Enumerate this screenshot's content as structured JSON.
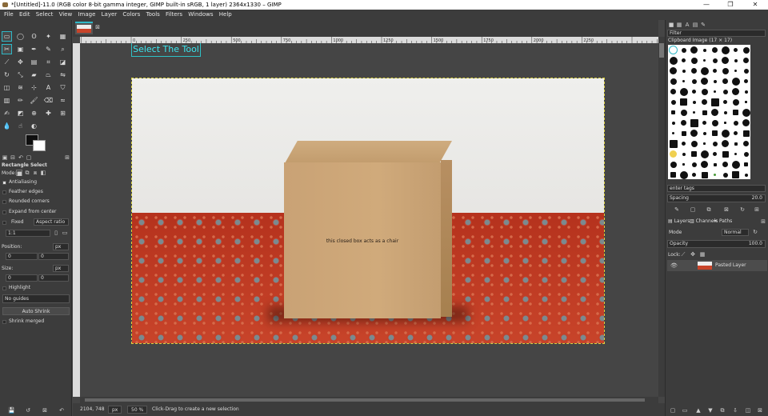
{
  "window": {
    "title": "*[Untitled]-11.0 (RGB color 8-bit gamma integer, GIMP built-in sRGB, 1 layer) 2364x1330 – GIMP",
    "min_glyph": "—",
    "max_glyph": "❐",
    "close_glyph": "✕"
  },
  "menu": [
    "File",
    "Edit",
    "Select",
    "View",
    "Image",
    "Layer",
    "Colors",
    "Tools",
    "Filters",
    "Windows",
    "Help"
  ],
  "tool_options": {
    "title": "Rectangle Select",
    "mode_label": "Mode:",
    "antialiasing": "Antialiasing",
    "feather": "Feather edges",
    "rounded": "Rounded corners",
    "expand": "Expand from center",
    "fixed_label": "Fixed",
    "fixed_value": "Aspect ratio",
    "ratio_value": "1:1",
    "position_label": "Position:",
    "position_x": "0",
    "position_y": "0",
    "size_label": "Size:",
    "size_w": "0",
    "size_h": "0",
    "unit": "px",
    "highlight": "Highlight",
    "guides": "No guides",
    "auto_shrink": "Auto Shrink",
    "shrink_merged": "Shrink merged"
  },
  "canvas": {
    "hint": "Select The Tool",
    "box_text": "this closed box acts as a chair",
    "ruler_ticks": [
      "0",
      "250",
      "500",
      "750",
      "1000",
      "1250",
      "1500",
      "1750",
      "2000",
      "2250"
    ]
  },
  "status": {
    "coords": "2104, 748",
    "unit": "px",
    "zoom": "50 %",
    "message": "Click-Drag to create a new selection"
  },
  "right_panel": {
    "filter_placeholder": "Filter",
    "brush_name": "Clipboard Image (17 × 17)",
    "tags_placeholder": "enter tags",
    "spacing_label": "Spacing",
    "spacing_value": "20.0",
    "tabs": [
      "Layers",
      "Channels",
      "Paths"
    ],
    "mode_label": "Mode",
    "mode_value": "Normal",
    "opacity_label": "Opacity",
    "opacity_value": "100.0",
    "lock_label": "Lock:",
    "layer_name": "Pasted Layer"
  },
  "colors": {
    "accent": "#2fb8c7",
    "selection": "#d9d040"
  }
}
